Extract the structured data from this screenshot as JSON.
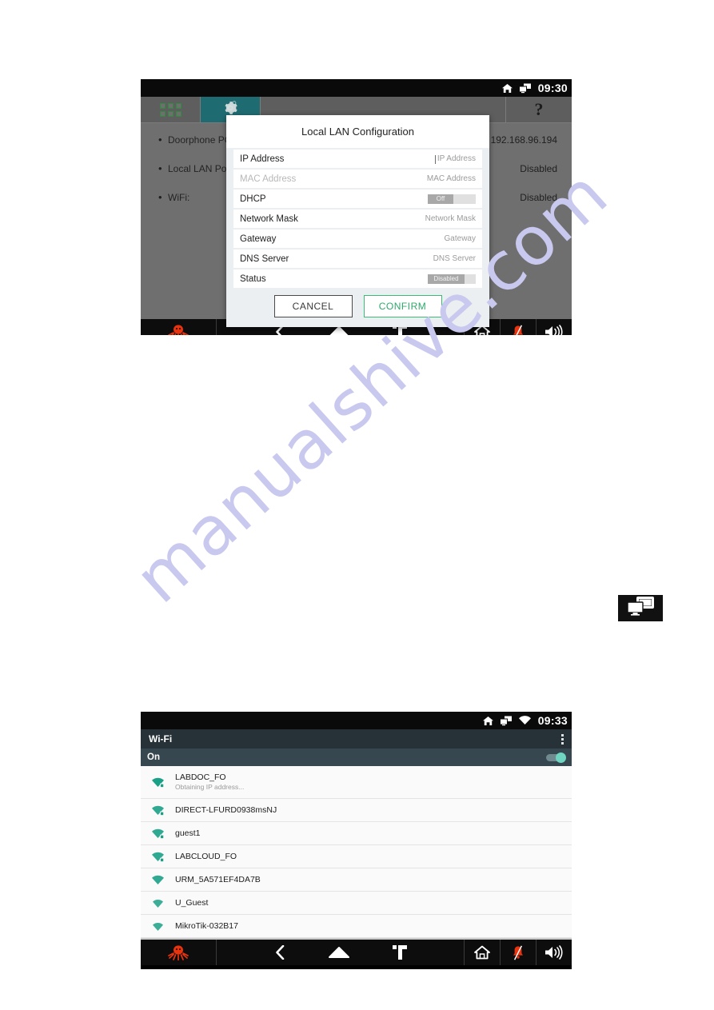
{
  "watermark": {
    "text": "manualshive.com"
  },
  "top_screen": {
    "statusbar": {
      "time": "09:30",
      "icons": [
        "home-icon",
        "network-icon"
      ]
    },
    "tabs": [
      {
        "name": "apps-grid-tab",
        "icon": "grid-icon",
        "active": false
      },
      {
        "name": "settings-gear-tab",
        "icon": "gear-icon",
        "active": true
      }
    ],
    "help_label": "?",
    "settings": [
      {
        "label": "Doorphone POE:",
        "value": "192.168.96.194"
      },
      {
        "label": "Local LAN Port:",
        "value": "Disabled"
      },
      {
        "label": "WiFi:",
        "value": "Disabled"
      }
    ],
    "modal": {
      "title": "Local LAN Configuration",
      "fields": [
        {
          "label": "IP Address",
          "placeholder": "IP Address",
          "type": "text",
          "dim": false
        },
        {
          "label": "MAC Address",
          "placeholder": "MAC Address",
          "type": "text",
          "dim": true
        },
        {
          "label": "DHCP",
          "toggle_label": "Off",
          "type": "toggle",
          "dim": false
        },
        {
          "label": "Network Mask",
          "placeholder": "Network Mask",
          "type": "text",
          "dim": false
        },
        {
          "label": "Gateway",
          "placeholder": "Gateway",
          "type": "text",
          "dim": false
        },
        {
          "label": "DNS Server",
          "placeholder": "DNS Server",
          "type": "text",
          "dim": false
        },
        {
          "label": "Status",
          "toggle_label": "Disabled",
          "type": "toggle",
          "dim": false
        }
      ],
      "cancel_label": "CANCEL",
      "confirm_label": "CONFIRM",
      "confirm_color": "#3cb878"
    },
    "navbar": {
      "left_icon": "octopus-logo-icon",
      "buttons": [
        "back-icon",
        "home-icon",
        "recent-apps-icon"
      ],
      "right_buttons": [
        "house-icon",
        "bell-muted-icon",
        "volume-icon"
      ]
    }
  },
  "lone_icon": {
    "name": "network-lan-icon"
  },
  "bottom_screen": {
    "statusbar": {
      "time": "09:33",
      "icons": [
        "home-icon",
        "network-icon",
        "wifi-icon"
      ]
    },
    "header": {
      "title": "Wi-Fi",
      "menu_icon": "kebab-menu-icon"
    },
    "power_row": {
      "label": "On",
      "enabled": true,
      "accent": "#6fd4c0"
    },
    "networks": [
      {
        "ssid": "LABDOC_FO",
        "status": "Obtaining IP address...",
        "secured": true,
        "signal": 4
      },
      {
        "ssid": "DIRECT-LFURD0938msNJ",
        "status": "",
        "secured": true,
        "signal": 3
      },
      {
        "ssid": "guest1",
        "status": "",
        "secured": true,
        "signal": 3
      },
      {
        "ssid": "LABCLOUD_FO",
        "status": "",
        "secured": true,
        "signal": 3
      },
      {
        "ssid": "URM_5A571EF4DA7B",
        "status": "",
        "secured": false,
        "signal": 3
      },
      {
        "ssid": "U_Guest",
        "status": "",
        "secured": false,
        "signal": 2
      },
      {
        "ssid": "MikroTik-032B17",
        "status": "",
        "secured": false,
        "signal": 2
      }
    ],
    "navbar": {
      "left_icon": "octopus-logo-icon",
      "buttons": [
        "back-icon",
        "home-icon",
        "recent-apps-icon"
      ],
      "right_buttons": [
        "house-icon",
        "bell-muted-icon",
        "volume-icon"
      ]
    }
  }
}
